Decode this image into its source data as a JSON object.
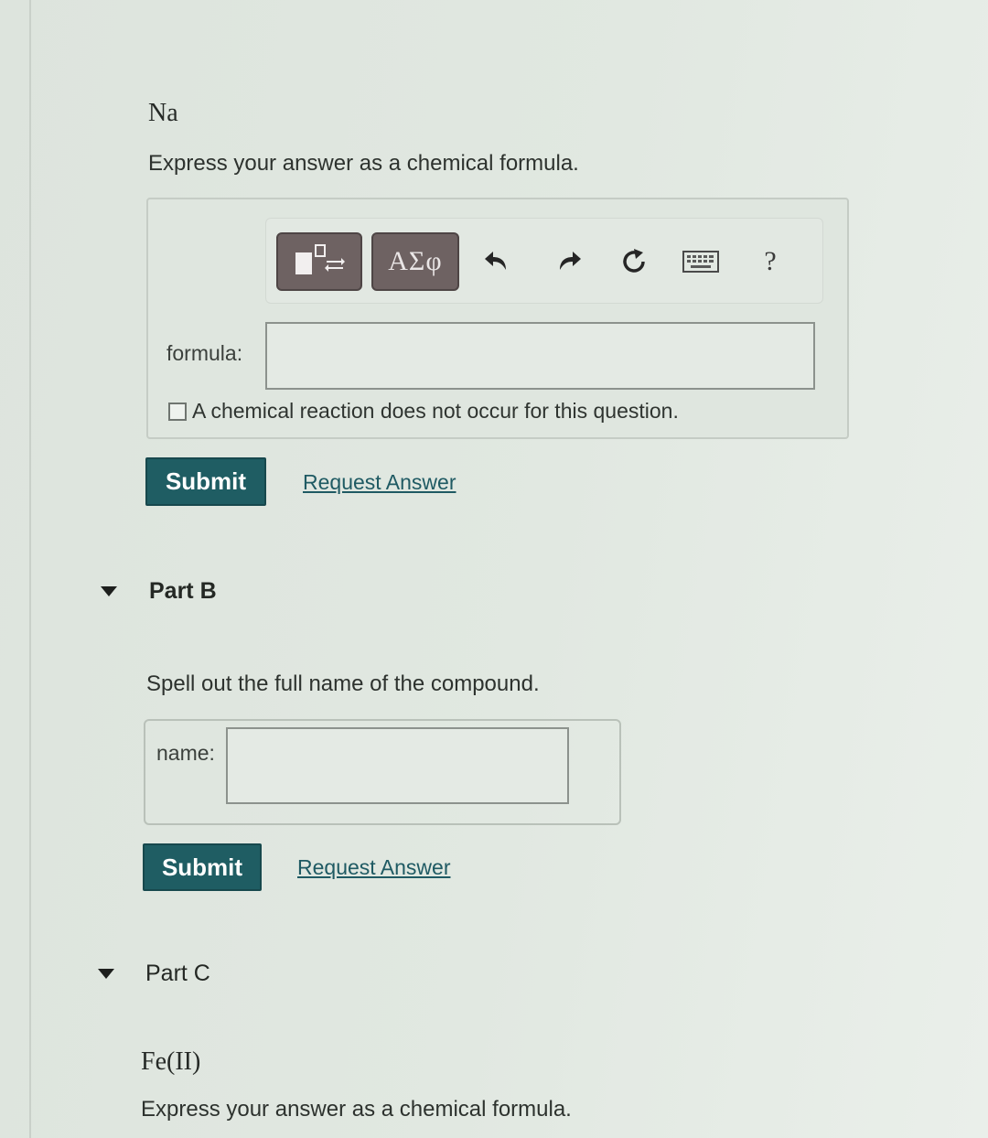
{
  "part_a": {
    "element": "Na",
    "instruction": "Express your answer as a chemical formula.",
    "toolbar": {
      "templates_icon": "templates-icon",
      "greek_label": "ΑΣφ",
      "undo_icon": "undo-icon",
      "redo_icon": "redo-icon",
      "reset_icon": "reset-icon",
      "keyboard_icon": "keyboard-icon",
      "help_label": "?"
    },
    "formula_label": "formula:",
    "formula_value": "",
    "no_reaction_label": "A chemical reaction does not occur for this question.",
    "no_reaction_checked": false,
    "submit_label": "Submit",
    "request_label": "Request Answer"
  },
  "part_b": {
    "title": "Part B",
    "instruction": "Spell out the full name of the compound.",
    "name_label": "name:",
    "name_value": "",
    "submit_label": "Submit",
    "request_label": "Request Answer"
  },
  "part_c": {
    "title": "Part C",
    "element": "Fe(II)",
    "instruction": "Express your answer as a chemical formula."
  },
  "colors": {
    "submit_bg": "#1f5d63",
    "link": "#1f5a63",
    "toolbar_button": "#6e6262"
  }
}
